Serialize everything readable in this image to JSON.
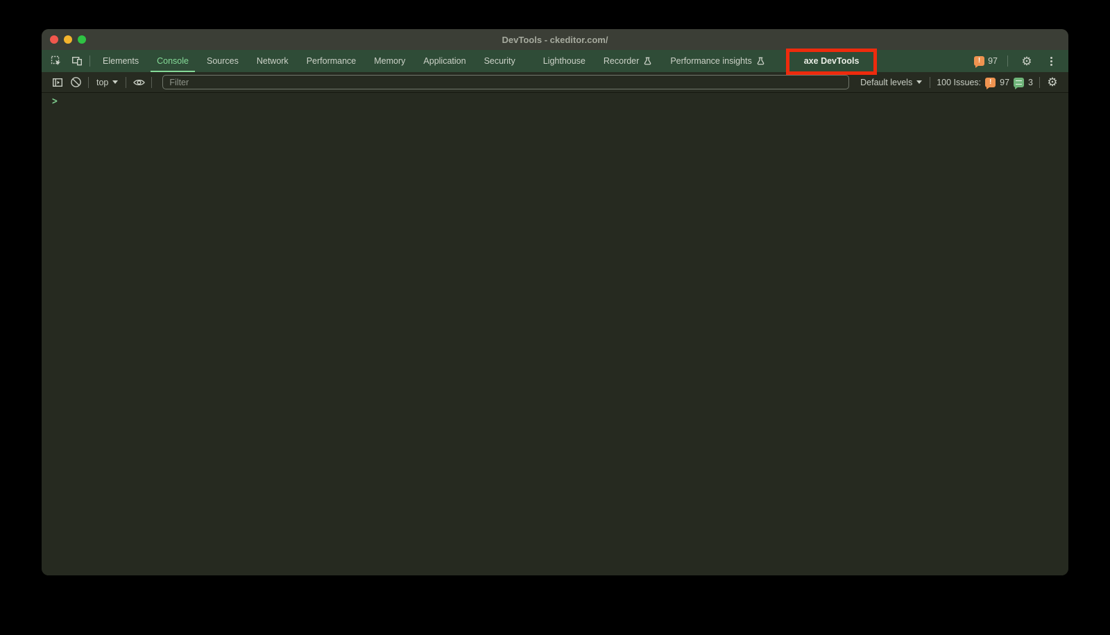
{
  "window": {
    "title": "DevTools - ckeditor.com/"
  },
  "tabbar": {
    "tabs": [
      {
        "label": "Elements"
      },
      {
        "label": "Console",
        "selected": true
      },
      {
        "label": "Sources"
      },
      {
        "label": "Network"
      },
      {
        "label": "Performance"
      },
      {
        "label": "Memory"
      },
      {
        "label": "Application"
      },
      {
        "label": "Security"
      },
      {
        "label": "Lighthouse"
      },
      {
        "label": "Recorder",
        "experimental": true
      },
      {
        "label": "Performance insights",
        "experimental": true
      },
      {
        "label": "axe DevTools",
        "highlighted": true
      }
    ],
    "error_badge_count": "97"
  },
  "toolbar": {
    "context_selector": "top",
    "filter_placeholder": "Filter",
    "levels_selector": "Default levels",
    "issues_label": "100 Issues:",
    "error_count": "97",
    "message_count": "3"
  },
  "console": {
    "prompt": ">"
  },
  "icons": {
    "gear_glyph": "⚙",
    "error_badge_glyph": "!"
  },
  "colors": {
    "accent_green": "#85da98",
    "annotation_red": "#ee2b0d",
    "error_badge_orange": "#ef9350",
    "message_badge_green": "#6fb479",
    "tabbar_green": "#2f4c37",
    "titlebar_gray": "#3b3e36"
  }
}
